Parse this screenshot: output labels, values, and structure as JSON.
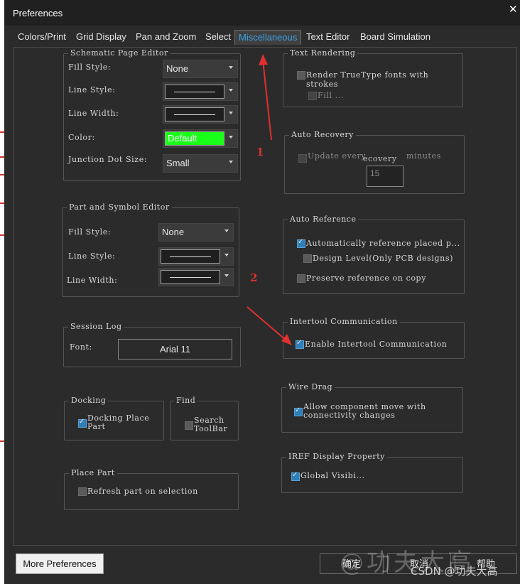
{
  "window": {
    "title": "Preferences",
    "close_icon": "close-icon"
  },
  "tabs": [
    "Colors/Print",
    "Grid Display",
    "Pan and Zoom",
    "Select",
    "Miscellaneous",
    "Text Editor",
    "Board Simulation"
  ],
  "active_tab": "Miscellaneous",
  "schematic_page_editor": {
    "title": "Schematic Page Editor",
    "fill_style_label": "Fill Style:",
    "fill_style_value": "None",
    "line_style_label": "Line Style:",
    "line_width_label": "Line Width:",
    "color_label": "Color:",
    "color_value": "Default",
    "color_swatch": "#1aff1a",
    "junction_label": "Junction Dot Size:",
    "junction_value": "Small"
  },
  "part_symbol_editor": {
    "title": "Part and Symbol Editor",
    "fill_style_label": "Fill Style:",
    "fill_style_value": "None",
    "line_style_label": "Line Style:",
    "line_width_label": "Line Width:"
  },
  "session_log": {
    "title": "Session Log",
    "font_label": "Font:",
    "font_value": "Arial 11"
  },
  "docking": {
    "title": "Docking",
    "option_line1": "Docking Place",
    "option_line2": "Part",
    "checked": true
  },
  "find": {
    "title": "Find",
    "option_line1": "Search",
    "option_line2": "ToolBar",
    "checked": false
  },
  "place_part": {
    "title": "Place Part",
    "option": "Refresh part on selection",
    "checked": false
  },
  "text_rendering": {
    "title": "Text Rendering",
    "option": "Render TrueType fonts with strokes",
    "fill": "Fill ..."
  },
  "auto_recovery": {
    "title": "Auto Recovery",
    "update_every": "Update every",
    "recovery_frag": "ecovery",
    "minutes": "minutes",
    "value": "15"
  },
  "auto_reference": {
    "title": "Auto Reference",
    "auto_place": "Automatically reference placed p...",
    "design_level": "Design Level(Only PCB designs)",
    "preserve": "Preserve reference on copy"
  },
  "intertool": {
    "title": "Intertool Communication",
    "option": "Enable Intertool Communication"
  },
  "wire_drag": {
    "title": "Wire Drag",
    "option_line1": "Allow component move with",
    "option_line2": "connectivity changes"
  },
  "iref": {
    "title": "IREF Display Property",
    "option": "Global Visibi..."
  },
  "buttons": {
    "more": "More Preferences",
    "ok": "确定",
    "cancel": "取消",
    "help": "帮助"
  },
  "annotations": {
    "one": "1",
    "two": "2",
    "color": "#e03030"
  },
  "watermark": {
    "big": "@功夫大高",
    "small": "CSDN @功夫大高"
  }
}
